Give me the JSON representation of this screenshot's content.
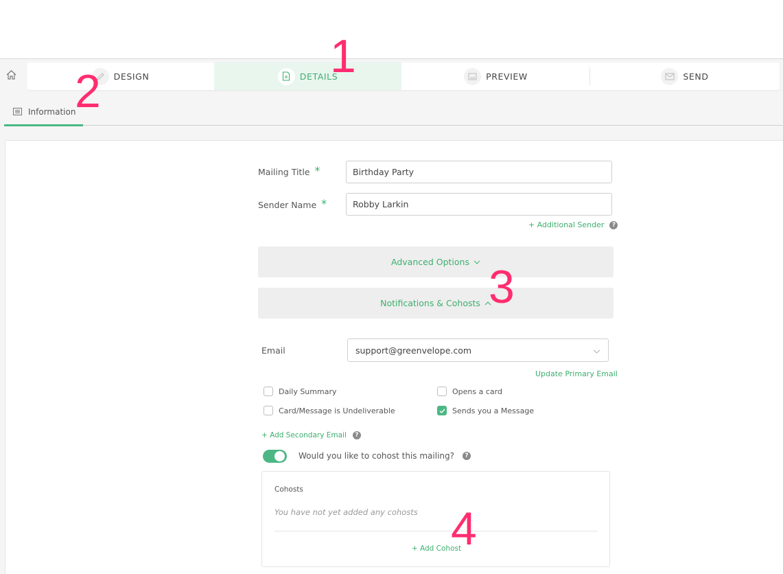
{
  "nav": {
    "home_icon": "home-icon",
    "steps": [
      {
        "label": "DESIGN",
        "icon": "pencil-icon",
        "active": false
      },
      {
        "label": "DETAILS",
        "icon": "document-icon",
        "active": true
      },
      {
        "label": "PREVIEW",
        "icon": "image-icon",
        "active": false
      },
      {
        "label": "SEND",
        "icon": "envelope-icon",
        "active": false
      }
    ]
  },
  "subtabs": [
    {
      "label": "Information",
      "icon": "list-icon",
      "active": true
    }
  ],
  "form": {
    "mailing_title": {
      "label": "Mailing Title",
      "required_mark": "*",
      "value": "Birthday Party"
    },
    "sender_name": {
      "label": "Sender Name",
      "required_mark": "*",
      "value": "Robby Larkin"
    },
    "additional_sender_link": "+ Additional Sender",
    "help_glyph": "?"
  },
  "accordions": {
    "advanced": {
      "label": "Advanced Options",
      "expanded": false
    },
    "notifications": {
      "label": "Notifications & Cohosts",
      "expanded": true
    }
  },
  "notifications": {
    "email_label": "Email",
    "email_value": "support@greenvelope.com",
    "update_primary_link": "Update Primary Email",
    "checkboxes": [
      {
        "label": "Daily Summary",
        "checked": false
      },
      {
        "label": "Opens a card",
        "checked": false
      },
      {
        "label": "Card/Message is Undeliverable",
        "checked": false
      },
      {
        "label": "Sends you a Message",
        "checked": true
      }
    ],
    "add_secondary_link": "+ Add Secondary Email",
    "cohost_toggle": {
      "label": "Would you like to cohost this mailing?",
      "on": true
    }
  },
  "cohosts": {
    "title": "Cohosts",
    "empty_text": "You have not yet added any cohosts",
    "add_link": "+ Add Cohost"
  },
  "annotations": [
    "1",
    "2",
    "3",
    "4"
  ],
  "colors": {
    "accent": "#3daf6e",
    "accent_fill": "#4cb784",
    "active_tab_bg": "#e8f6ee",
    "annotation": "#ff2d6f"
  }
}
